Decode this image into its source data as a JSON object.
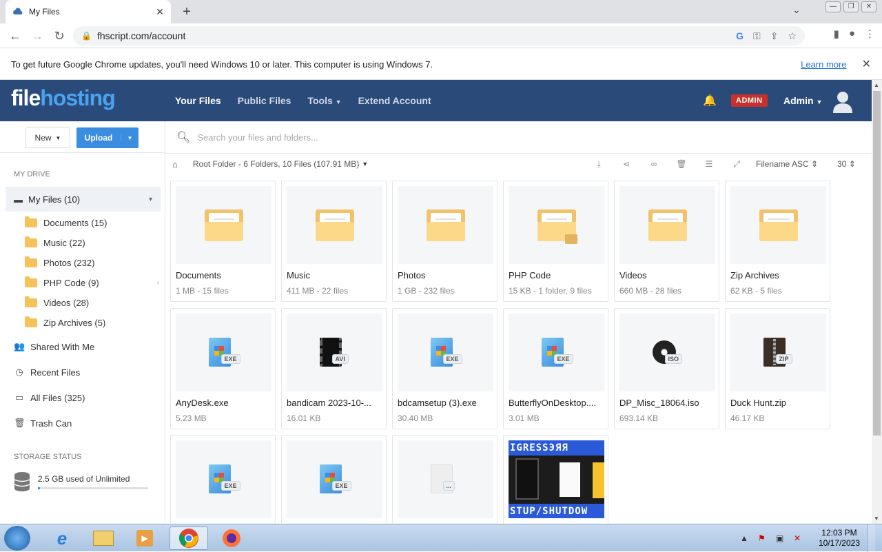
{
  "browser": {
    "tab_title": "My Files",
    "url": "fhscript.com/account"
  },
  "infobar": {
    "message": "To get future Google Chrome updates, you'll need Windows 10 or later. This computer is using Windows 7.",
    "link": "Learn more"
  },
  "header": {
    "logo_part1": "file",
    "logo_part2": "hosting",
    "nav": [
      "Your Files",
      "Public Files",
      "Tools",
      "Extend Account"
    ],
    "admin_badge": "ADMIN",
    "user": "Admin"
  },
  "sidebar": {
    "new_label": "New",
    "upload_label": "Upload",
    "my_drive": "MY DRIVE",
    "my_files": "My Files (10)",
    "folders": [
      "Documents (15)",
      "Music (22)",
      "Photos (232)",
      "PHP Code (9)",
      "Videos (28)",
      "Zip Archives (5)"
    ],
    "links": [
      "Shared With Me",
      "Recent Files",
      "All Files (325)",
      "Trash Can"
    ],
    "storage_heading": "STORAGE STATUS",
    "storage_text": "2.5 GB used of Unlimited",
    "storage_fill": 0.02
  },
  "main": {
    "search_placeholder": "Search your files and folders...",
    "breadcrumb": "Root Folder - 6 Folders, 10 Files (107.91 MB)",
    "sort": "Filename ASC",
    "per_page": "30",
    "folders": [
      {
        "name": "Documents",
        "meta": "1 MB - 15 files"
      },
      {
        "name": "Music",
        "meta": "411 MB - 22 files"
      },
      {
        "name": "Photos",
        "meta": "1 GB - 232 files"
      },
      {
        "name": "PHP Code",
        "meta": "15 KB - 1 folder, 9 files"
      },
      {
        "name": "Videos",
        "meta": "660 MB - 28 files"
      },
      {
        "name": "Zip Archives",
        "meta": "62 KB - 5 files"
      }
    ],
    "files": [
      {
        "name": "AnyDesk.exe",
        "meta": "5.23 MB",
        "ext": "EXE"
      },
      {
        "name": "bandicam 2023-10-...",
        "meta": "16.01 KB",
        "ext": "AVI"
      },
      {
        "name": "bdcamsetup (3).exe",
        "meta": "30.40 MB",
        "ext": "EXE"
      },
      {
        "name": "ButterflyOnDesktop....",
        "meta": "3.01 MB",
        "ext": "EXE"
      },
      {
        "name": "DP_Misc_18064.iso",
        "meta": "693.14 KB",
        "ext": "ISO"
      },
      {
        "name": "Duck Hunt.zip",
        "meta": "46.17 KB",
        "ext": "ZIP"
      }
    ],
    "row3_exts": [
      "EXE",
      "EXE",
      "..."
    ],
    "banner_text_top": "IGRESSЭЯЯ",
    "banner_text_bottom": "STUP/SHUTDOW"
  },
  "taskbar": {
    "time": "12:03 PM",
    "date": "10/17/2023"
  }
}
